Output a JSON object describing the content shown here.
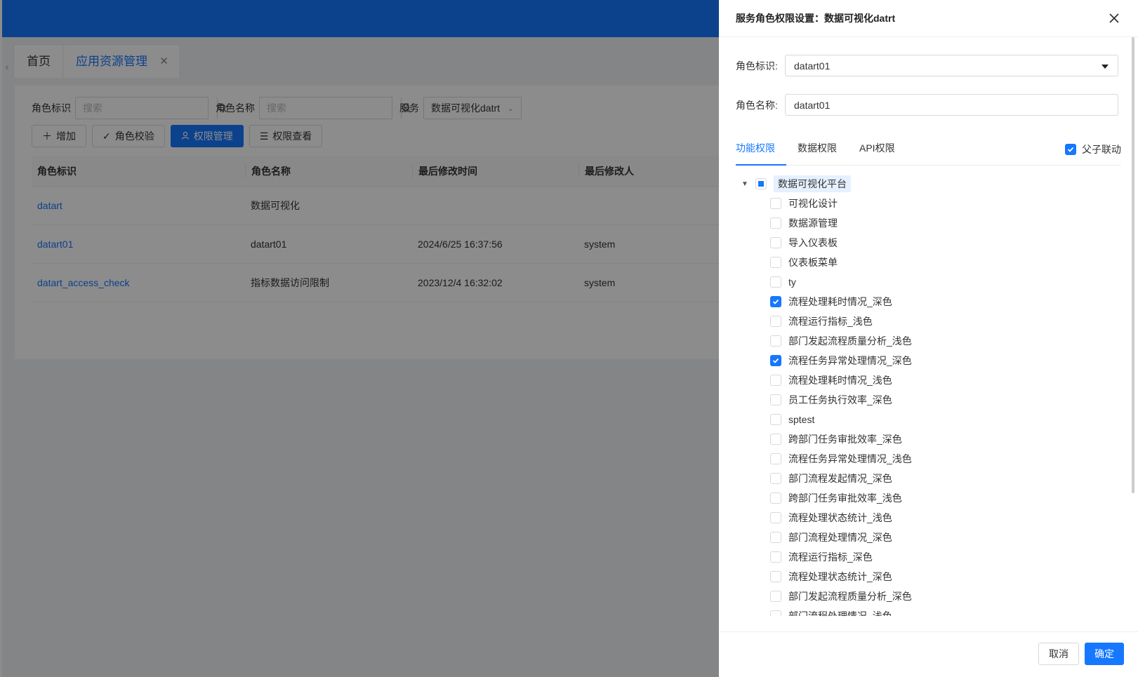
{
  "colors": {
    "primary": "#1677ff",
    "mask": "rgba(0,0,0,0.45)"
  },
  "tabs": {
    "home": "首页",
    "active": "应用资源管理"
  },
  "filters": {
    "role_id_label": "角色标识",
    "role_id_placeholder": "搜索",
    "role_name_label": "角色名称",
    "role_name_placeholder": "搜索",
    "service_label": "服务",
    "service_value": "数据可视化datrt"
  },
  "actions": {
    "add": "增加",
    "check": "角色校验",
    "manage": "权限管理",
    "view": "权限查看"
  },
  "table": {
    "headers": [
      "角色标识",
      "角色名称",
      "最后修改时间",
      "最后修改人"
    ],
    "rows": [
      {
        "id": "datart",
        "name": "数据可视化",
        "time": "",
        "user": ""
      },
      {
        "id": "datart01",
        "name": "datart01",
        "time": "2024/6/25 16:37:56",
        "user": "system"
      },
      {
        "id": "datart_access_check",
        "name": "指标数据访问限制",
        "time": "2023/12/4 16:32:02",
        "user": "system"
      }
    ]
  },
  "drawer": {
    "title": "服务角色权限设置：数据可视化datrt",
    "role_id_label": "角色标识:",
    "role_id_value": "datart01",
    "role_name_label": "角色名称:",
    "role_name_value": "datart01",
    "tabs": [
      "功能权限",
      "数据权限",
      "API权限"
    ],
    "linkage_label": "父子联动",
    "tree_root": "数据可视化平台",
    "tree_items": [
      {
        "label": "可视化设计",
        "checked": false
      },
      {
        "label": "数据源管理",
        "checked": false
      },
      {
        "label": "导入仪表板",
        "checked": false
      },
      {
        "label": "仪表板菜单",
        "checked": false
      },
      {
        "label": "ty",
        "checked": false
      },
      {
        "label": "流程处理耗时情况_深色",
        "checked": true
      },
      {
        "label": "流程运行指标_浅色",
        "checked": false
      },
      {
        "label": "部门发起流程质量分析_浅色",
        "checked": false
      },
      {
        "label": "流程任务异常处理情况_深色",
        "checked": true
      },
      {
        "label": "流程处理耗时情况_浅色",
        "checked": false
      },
      {
        "label": "员工任务执行效率_深色",
        "checked": false
      },
      {
        "label": "sptest",
        "checked": false
      },
      {
        "label": "跨部门任务审批效率_深色",
        "checked": false
      },
      {
        "label": "流程任务异常处理情况_浅色",
        "checked": false
      },
      {
        "label": "部门流程发起情况_深色",
        "checked": false
      },
      {
        "label": "跨部门任务审批效率_浅色",
        "checked": false
      },
      {
        "label": "流程处理状态统计_浅色",
        "checked": false
      },
      {
        "label": "部门流程处理情况_深色",
        "checked": false
      },
      {
        "label": "流程运行指标_深色",
        "checked": false
      },
      {
        "label": "流程处理状态统计_深色",
        "checked": false
      },
      {
        "label": "部门发起流程质量分析_深色",
        "checked": false
      },
      {
        "label": "部门流程处理情况_浅色",
        "checked": false
      }
    ],
    "cancel_label": "取消",
    "ok_label": "确定"
  }
}
